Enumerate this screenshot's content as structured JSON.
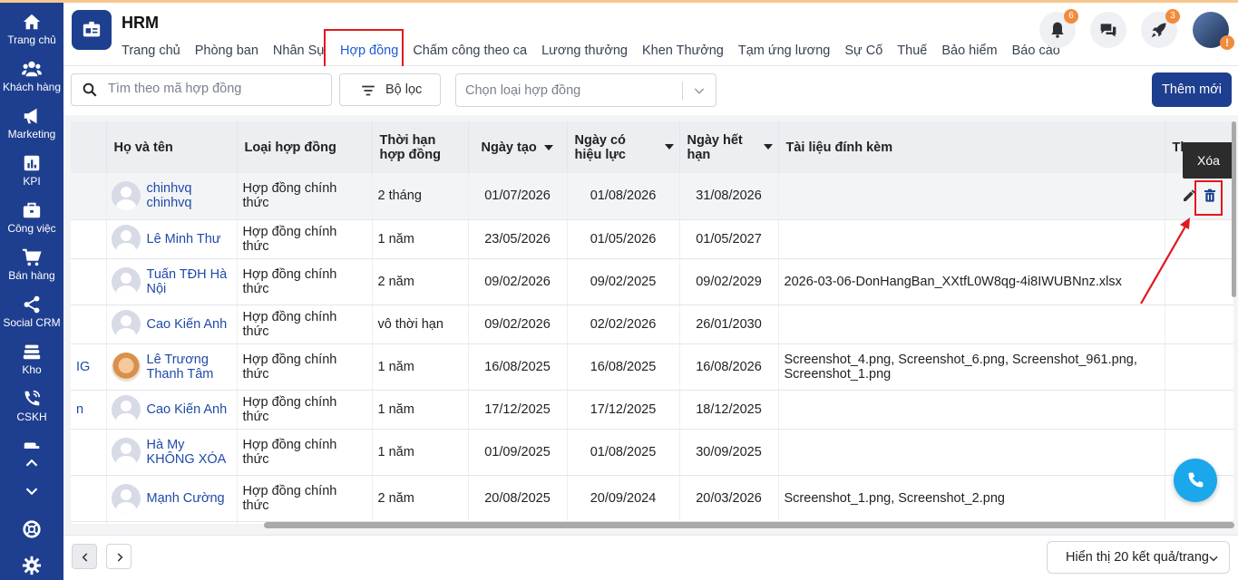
{
  "sidebar": {
    "items": [
      {
        "label": "Trang chủ",
        "icon": "home-icon"
      },
      {
        "label": "Khách hàng",
        "icon": "users-icon"
      },
      {
        "label": "Marketing",
        "icon": "megaphone-icon"
      },
      {
        "label": "KPI",
        "icon": "chart-icon"
      },
      {
        "label": "Công việc",
        "icon": "briefcase-icon"
      },
      {
        "label": "Bán hàng",
        "icon": "cart-icon"
      },
      {
        "label": "Social CRM",
        "icon": "share-icon"
      },
      {
        "label": "Kho",
        "icon": "warehouse-icon"
      },
      {
        "label": "CSKH",
        "icon": "phone-call-icon"
      }
    ]
  },
  "header": {
    "title": "HRM",
    "tabs": [
      {
        "label": "Trang chủ"
      },
      {
        "label": "Phòng ban"
      },
      {
        "label": "Nhân Sự"
      },
      {
        "label": "Hợp đồng",
        "active": true
      },
      {
        "label": "Chấm công theo ca"
      },
      {
        "label": "Lương thưởng"
      },
      {
        "label": "Khen Thưởng"
      },
      {
        "label": "Tạm ứng lương"
      },
      {
        "label": "Sự Cố"
      },
      {
        "label": "Thuế"
      },
      {
        "label": "Bảo hiểm"
      },
      {
        "label": "Báo cáo"
      }
    ],
    "notifications_count": "6",
    "rocket_count": "3",
    "avatar_warning": "!"
  },
  "toolbar": {
    "search_placeholder": "Tìm theo mã hợp đồng",
    "filter_label": "Bộ lọc",
    "contract_type_placeholder": "Chọn loại hợp đồng",
    "add_label": "Thêm mới"
  },
  "table": {
    "columns": {
      "name": "Họ và tên",
      "type": "Loại hợp đồng",
      "term": "Thời hạn hợp đồng",
      "created": "Ngày tạo",
      "effective": "Ngày có hiệu lực",
      "expire": "Ngày hết hạn",
      "attachments": "Tài liệu đính kèm",
      "actions": "Th"
    },
    "rows": [
      {
        "cut": "",
        "name": "chinhvq chinhvq",
        "type": "Hợp đồng chính thức",
        "term": "2 tháng",
        "created": "01/07/2026",
        "effective": "01/08/2026",
        "expire": "31/08/2026",
        "attachments": ""
      },
      {
        "cut": "",
        "name": "Lê Minh Thư",
        "type": "Hợp đồng chính thức",
        "term": "1 năm",
        "created": "23/05/2026",
        "effective": "01/05/2026",
        "expire": "01/05/2027",
        "attachments": ""
      },
      {
        "cut": "",
        "name": "Tuấn TĐH Hà Nội",
        "type": "Hợp đồng chính thức",
        "term": "2 năm",
        "created": "09/02/2026",
        "effective": "09/02/2025",
        "expire": "09/02/2029",
        "attachments": "2026-03-06-DonHangBan_XXtfL0W8qg-4i8IWUBNnz.xlsx"
      },
      {
        "cut": "",
        "name": "Cao Kiến Anh",
        "type": "Hợp đồng chính thức",
        "term": "vô thời hạn",
        "created": "09/02/2026",
        "effective": "02/02/2026",
        "expire": "26/01/2030",
        "attachments": ""
      },
      {
        "cut": "IG",
        "name": "Lê Trương Thanh Tâm",
        "type": "Hợp đồng chính thức",
        "term": "1 năm",
        "created": "16/08/2025",
        "effective": "16/08/2025",
        "expire": "16/08/2026",
        "attachments": "Screenshot_4.png, Screenshot_6.png, Screenshot_961.png, Screenshot_1.png"
      },
      {
        "cut": "n",
        "name": "Cao Kiến Anh",
        "type": "Hợp đồng chính thức",
        "term": "1 năm",
        "created": "17/12/2025",
        "effective": "17/12/2025",
        "expire": "18/12/2025",
        "attachments": ""
      },
      {
        "cut": "",
        "name": "Hà My KHÔNG XÓA",
        "type": "Hợp đồng chính thức",
        "term": "1 năm",
        "created": "01/09/2025",
        "effective": "01/08/2025",
        "expire": "30/09/2025",
        "attachments": ""
      },
      {
        "cut": "",
        "name": "Mạnh Cường",
        "type": "Hợp đồng chính thức",
        "term": "2 năm",
        "created": "20/08/2025",
        "effective": "20/09/2024",
        "expire": "20/03/2026",
        "attachments": "Screenshot_1.png, Screenshot_2.png"
      }
    ]
  },
  "tooltip": "Xóa",
  "footer": {
    "page_size_label": "Hiển thị 20 kết quả/trang"
  },
  "colors": {
    "sidebar": "#1e3f8f",
    "accent": "#1e5bd6",
    "highlight": "#e0181f",
    "call": "#1aa7ec"
  }
}
